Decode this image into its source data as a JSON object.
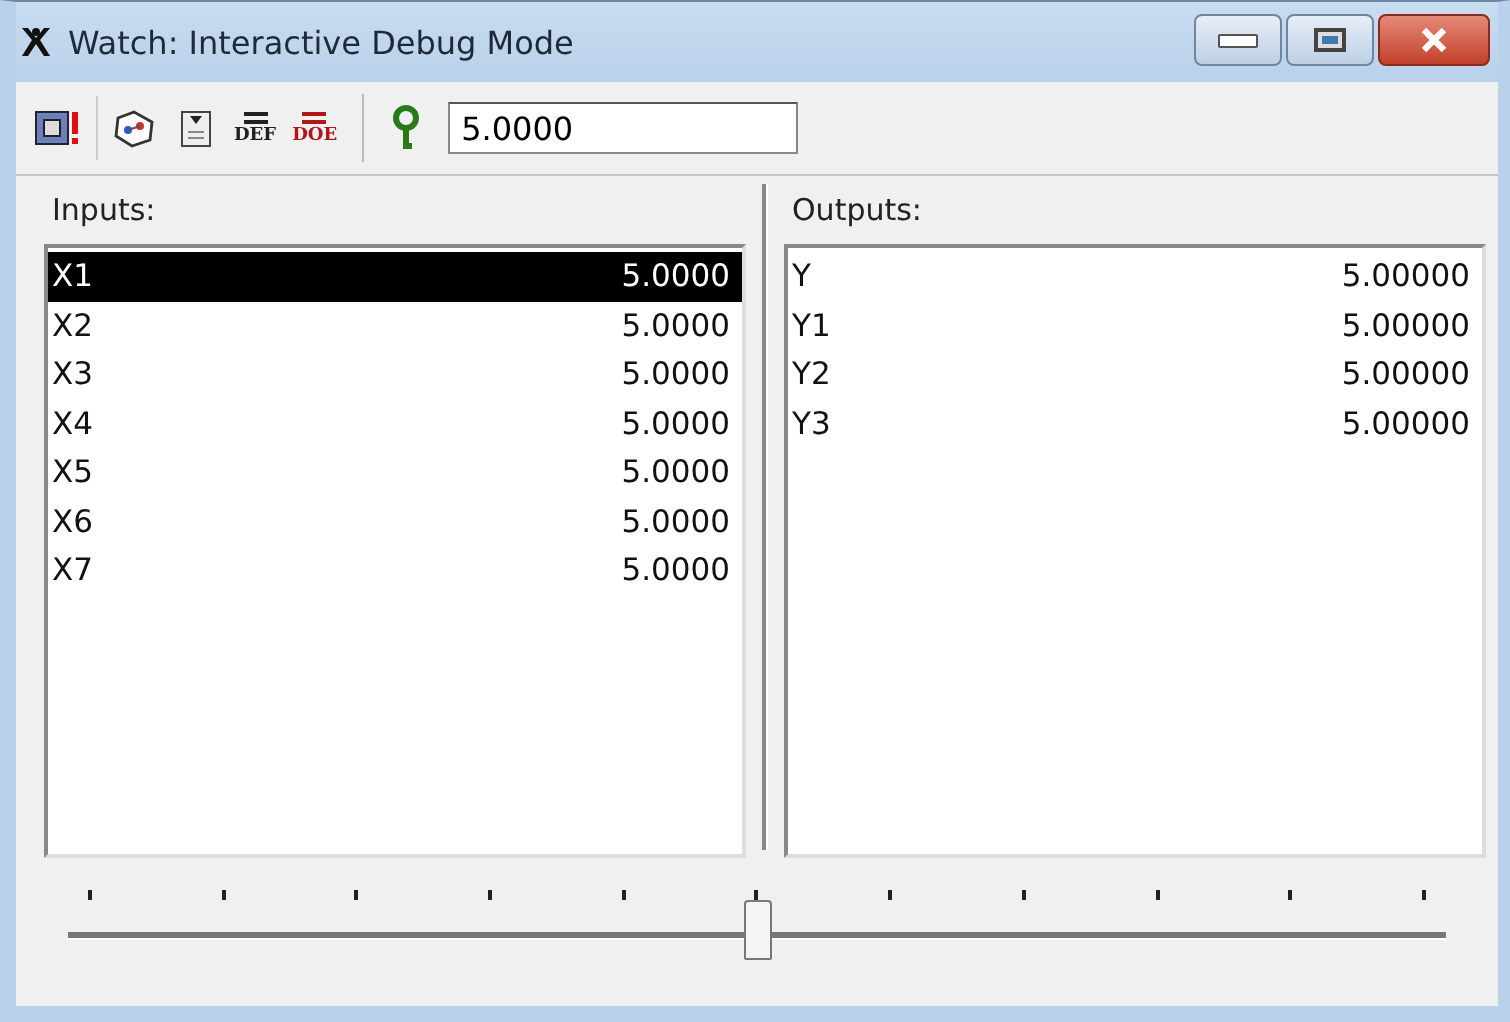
{
  "window": {
    "title": "Watch: Interactive Debug Mode"
  },
  "toolbar": {
    "buttons": [
      {
        "kind": "debug"
      },
      {
        "kind": "network"
      },
      {
        "kind": "clipboard"
      },
      {
        "kind": "text",
        "label": "DEF",
        "color": "#202020"
      },
      {
        "kind": "text",
        "label": "DOE",
        "color": "#b01818"
      }
    ],
    "help": {
      "kind": "key"
    },
    "value": "5.0000"
  },
  "inputs": {
    "label": "Inputs:",
    "items": [
      {
        "name": "X1",
        "value": "5.0000",
        "selected": true
      },
      {
        "name": "X2",
        "value": "5.0000",
        "selected": false
      },
      {
        "name": "X3",
        "value": "5.0000",
        "selected": false
      },
      {
        "name": "X4",
        "value": "5.0000",
        "selected": false
      },
      {
        "name": "X5",
        "value": "5.0000",
        "selected": false
      },
      {
        "name": "X6",
        "value": "5.0000",
        "selected": false
      },
      {
        "name": "X7",
        "value": "5.0000",
        "selected": false
      }
    ]
  },
  "outputs": {
    "label": "Outputs:",
    "items": [
      {
        "name": "Y",
        "value": "5.00000",
        "selected": false
      },
      {
        "name": "Y1",
        "value": "5.00000",
        "selected": false
      },
      {
        "name": "Y2",
        "value": "5.00000",
        "selected": false
      },
      {
        "name": "Y3",
        "value": "5.00000",
        "selected": false
      }
    ]
  },
  "slider": {
    "level": 0.5
  }
}
